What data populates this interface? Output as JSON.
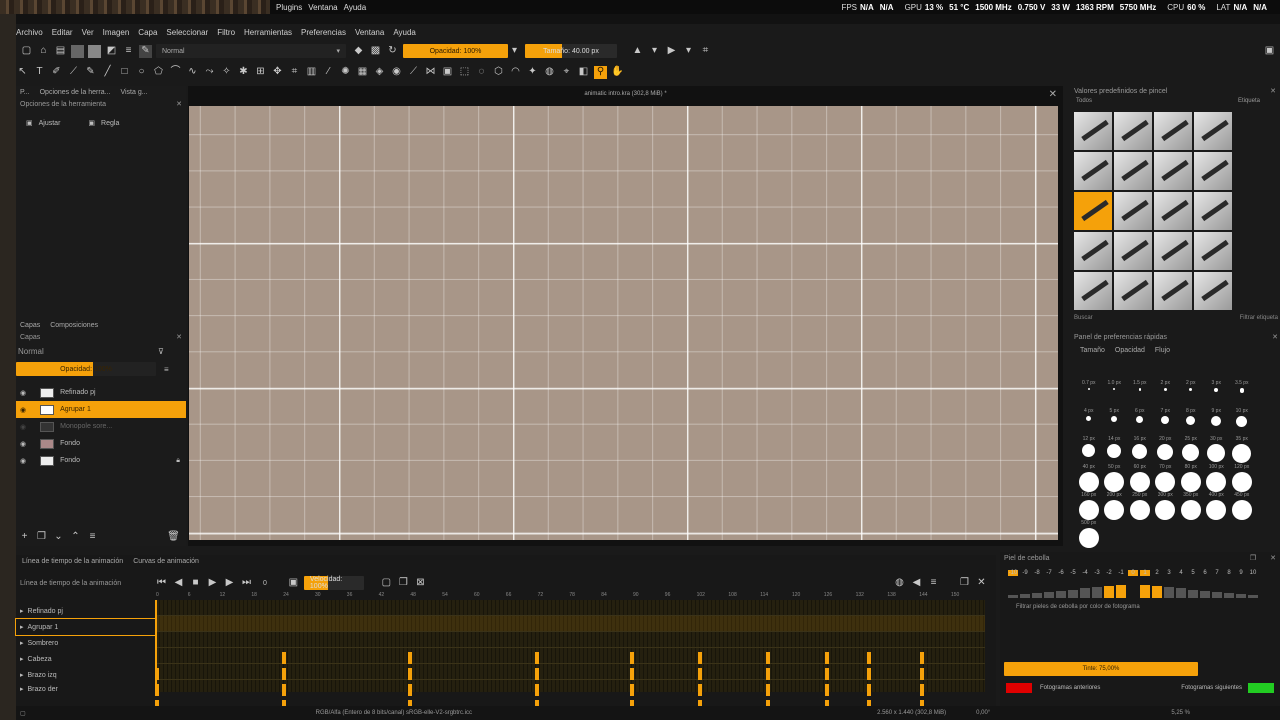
{
  "os_menu": [
    "Plugins",
    "Ventana",
    "Ayuda"
  ],
  "stats": {
    "fps_label": "FPS",
    "fps": "N/A",
    "fps2": "N/A",
    "gpu_label": "GPU",
    "gpu": "13 %",
    "gpu_temp": "51 °C",
    "gpu_clock": "1500 MHz",
    "gpu_volt": "0.750 V",
    "gpu_power": "33 W",
    "gpu_fan": "1363 RPM",
    "gpu_mem": "5750 MHz",
    "cpu_label": "CPU",
    "cpu": "60 %",
    "lat_label": "LAT",
    "lat": "N/A",
    "lat2": "N/A"
  },
  "menubar": [
    "Archivo",
    "Editar",
    "Ver",
    "Imagen",
    "Capa",
    "Seleccionar",
    "Filtro",
    "Herramientas",
    "Preferencias",
    "Ventana",
    "Ayuda"
  ],
  "toolbar": {
    "blend_mode": "Normal",
    "opacity": "Opacidad: 100%",
    "size": "Tamaño: 40.00 px"
  },
  "tool_options": {
    "tabs": [
      "P...",
      "Opciones de la herra...",
      "Vista g..."
    ],
    "title": "Opciones de la herramienta",
    "opt1": "Ajustar",
    "opt2": "Regla"
  },
  "layers": {
    "tabs": [
      "Capas",
      "Composiciones"
    ],
    "title": "Capas",
    "blend": "Normal",
    "opacity": "Opacidad: 100%",
    "items": [
      "Refinado pj",
      "Agrupar 1",
      "Monopole sore...",
      "Fondo",
      "Fondo"
    ]
  },
  "canvas": {
    "title": "animatic intro.kra (302,8 MiB) *"
  },
  "brush_presets": {
    "title": "Valores predefinidos de pincel",
    "filter": "Todos",
    "tag": "Etiqueta",
    "search": "Buscar",
    "filter_tag": "Filtrar etiqueta"
  },
  "fav_panel": {
    "title": "Panel de preferencias rápidas",
    "tabs": [
      "Tamaño",
      "Opacidad",
      "Flujo"
    ],
    "sizes": [
      "0.7 px",
      "1.0 px",
      "1.5 px",
      "2 px",
      "2 px",
      "3 px",
      "3.5 px",
      "4 px",
      "5 px",
      "6 px",
      "7 px",
      "8 px",
      "9 px",
      "10 px",
      "12 px",
      "14 px",
      "16 px",
      "20 px",
      "25 px",
      "30 px",
      "35 px",
      "40 px",
      "50 px",
      "60 px",
      "70 px",
      "80 px",
      "100 px",
      "120 px",
      "160 px",
      "200 px",
      "250 px",
      "300 px",
      "350 px",
      "400 px",
      "450 px",
      "500 px"
    ]
  },
  "timeline": {
    "tabs": [
      "Línea de tiempo de la animación",
      "Curvas de animación"
    ],
    "title": "Línea de tiempo de la animación",
    "frame": "0",
    "speed": "Velocidad: 100%",
    "ruler": [
      "0",
      "6",
      "12",
      "18",
      "24",
      "30",
      "36",
      "42",
      "48",
      "54",
      "60",
      "66",
      "72",
      "78",
      "84",
      "90",
      "96",
      "102",
      "108",
      "114",
      "120",
      "126",
      "132",
      "138",
      "144",
      "150"
    ],
    "tracks": [
      "Refinado pj",
      "Agrupar 1",
      "Sombrero",
      "Cabeza",
      "Brazo izq",
      "Brazo der"
    ]
  },
  "onion": {
    "title": "Piel de cebolla",
    "frames": [
      "-10",
      "-9",
      "-8",
      "-7",
      "-6",
      "-5",
      "-4",
      "-3",
      "-2",
      "-1",
      "0",
      "1",
      "2",
      "3",
      "4",
      "5",
      "6",
      "7",
      "8",
      "9",
      "10"
    ],
    "filter": "Filtrar pieles de cebolla por color de fotograma",
    "tint": "Tinte: 75,00%",
    "prev": "Fotogramas anteriores",
    "next": "Fotogramas siguientes",
    "prev_color": "#e00000",
    "next_color": "#22cc22"
  },
  "status": {
    "color": "RGB/Alfa (Entero de 8 bits/canal)  sRGB-elle-V2-srgbtrc.icc",
    "dims": "2.560 x 1.440 (302,8 MiB)",
    "rot": "0,00°",
    "zoom": "5,25 %"
  },
  "accent": "#f5a10a"
}
